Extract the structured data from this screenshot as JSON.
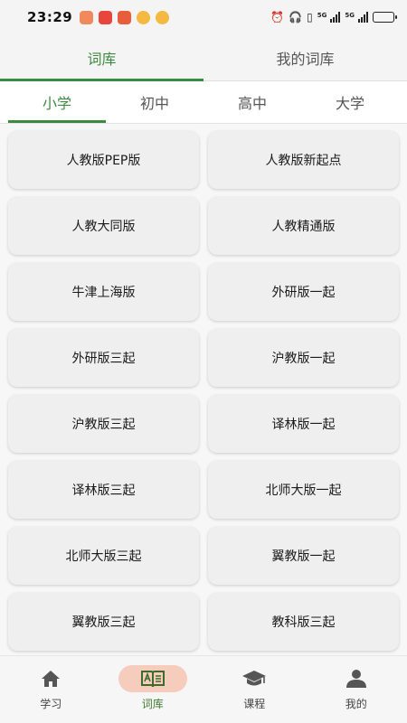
{
  "status_bar": {
    "time": "23:29",
    "network_1": "5G",
    "network_2": "5G",
    "battery_level": 0.75
  },
  "main_tabs": [
    {
      "label": "词库",
      "active": true
    },
    {
      "label": "我的词库",
      "active": false
    }
  ],
  "sub_tabs": [
    {
      "label": "小学",
      "active": true
    },
    {
      "label": "初中",
      "active": false
    },
    {
      "label": "高中",
      "active": false
    },
    {
      "label": "大学",
      "active": false
    }
  ],
  "textbooks": [
    "人教版PEP版",
    "人教版新起点",
    "人教大同版",
    "人教精通版",
    "牛津上海版",
    "外研版一起",
    "外研版三起",
    "沪教版一起",
    "沪教版三起",
    "译林版一起",
    "译林版三起",
    "北师大版一起",
    "北师大版三起",
    "翼教版一起",
    "翼教版三起",
    "教科版三起"
  ],
  "bottom_nav": [
    {
      "label": "学习",
      "icon": "home-icon",
      "active": false
    },
    {
      "label": "词库",
      "icon": "word-book-icon",
      "active": true
    },
    {
      "label": "课程",
      "icon": "graduation-cap-icon",
      "active": false
    },
    {
      "label": "我的",
      "icon": "person-icon",
      "active": false
    }
  ],
  "colors": {
    "accent": "#3d8b40",
    "nav_active_bg": "#f6cdbd"
  }
}
